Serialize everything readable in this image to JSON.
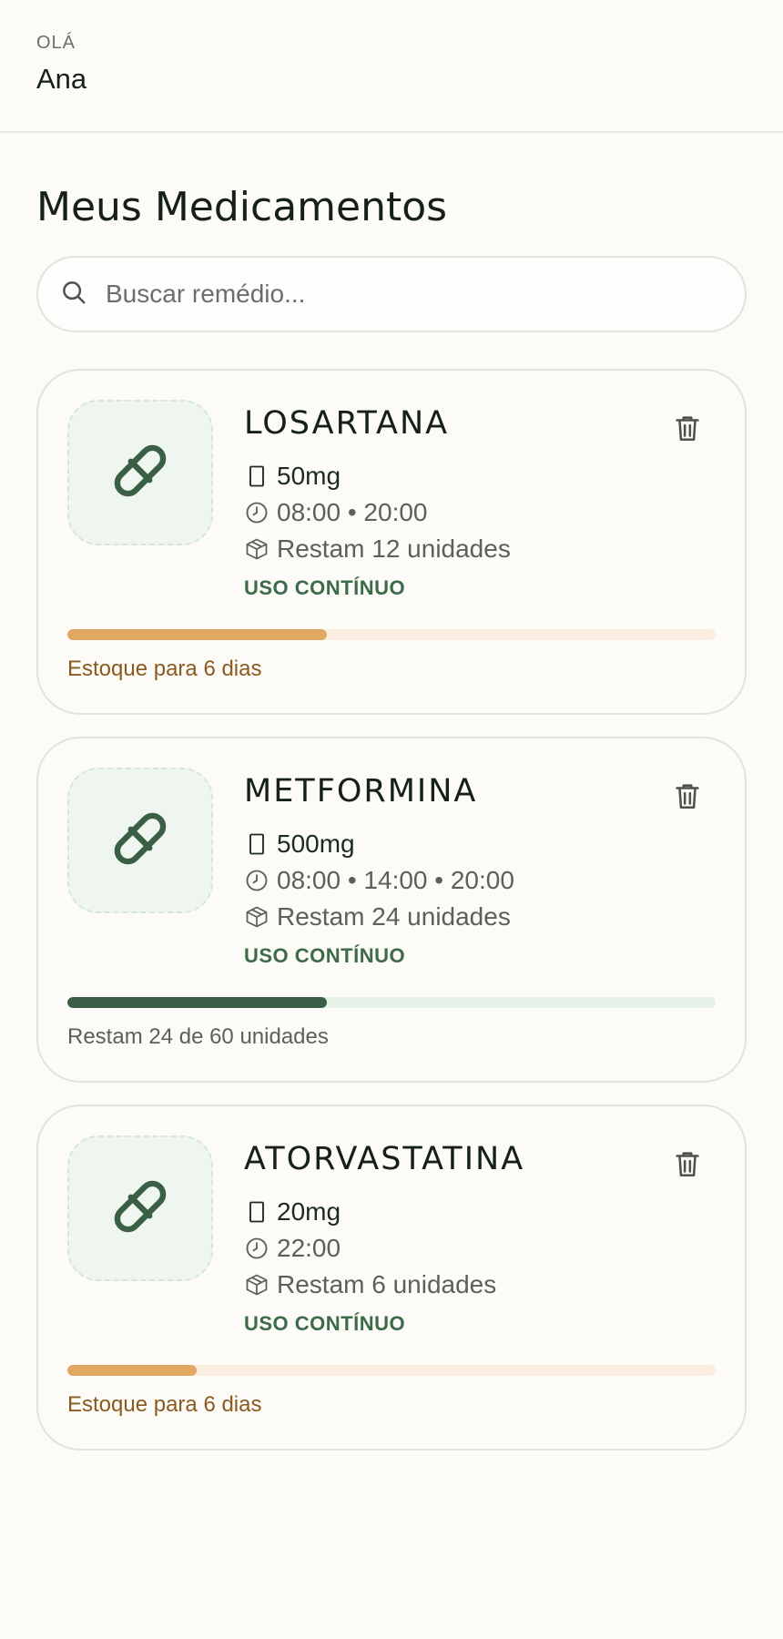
{
  "header": {
    "greeting": "OLÁ",
    "user_name": "Ana"
  },
  "page_title": "Meus Medicamentos",
  "search": {
    "placeholder": "Buscar remédio..."
  },
  "colors": {
    "accent_green": "#3b5e47",
    "warning_orange": "#e0a862",
    "warning_text": "#8a5a1e",
    "background": "#fcfbf8"
  },
  "medications": [
    {
      "name": "LOSARTANA",
      "dose": "50mg",
      "schedule": "08:00 • 20:00",
      "remaining_text": "Restam 12 unidades",
      "tag": "USO CONTÍNUO",
      "stock_fraction": 0.4,
      "stock_status": "warn",
      "stock_label": "Estoque para 6 dias"
    },
    {
      "name": "METFORMINA",
      "dose": "500mg",
      "schedule": "08:00 • 14:00 • 20:00",
      "remaining_text": "Restam 24 unidades",
      "tag": "USO CONTÍNUO",
      "stock_fraction": 0.4,
      "stock_status": "ok",
      "stock_label": "Restam 24 de 60 unidades"
    },
    {
      "name": "ATORVASTATINA",
      "dose": "20mg",
      "schedule": "22:00",
      "remaining_text": "Restam 6 unidades",
      "tag": "USO CONTÍNUO",
      "stock_fraction": 0.2,
      "stock_status": "warn",
      "stock_label": "Estoque para 6 dias"
    }
  ],
  "icons": {
    "dose": "dose-icon",
    "schedule": "clock-icon",
    "remaining": "box-icon",
    "delete": "trash-icon",
    "thumb": "pill-icon",
    "search": "search-icon"
  }
}
